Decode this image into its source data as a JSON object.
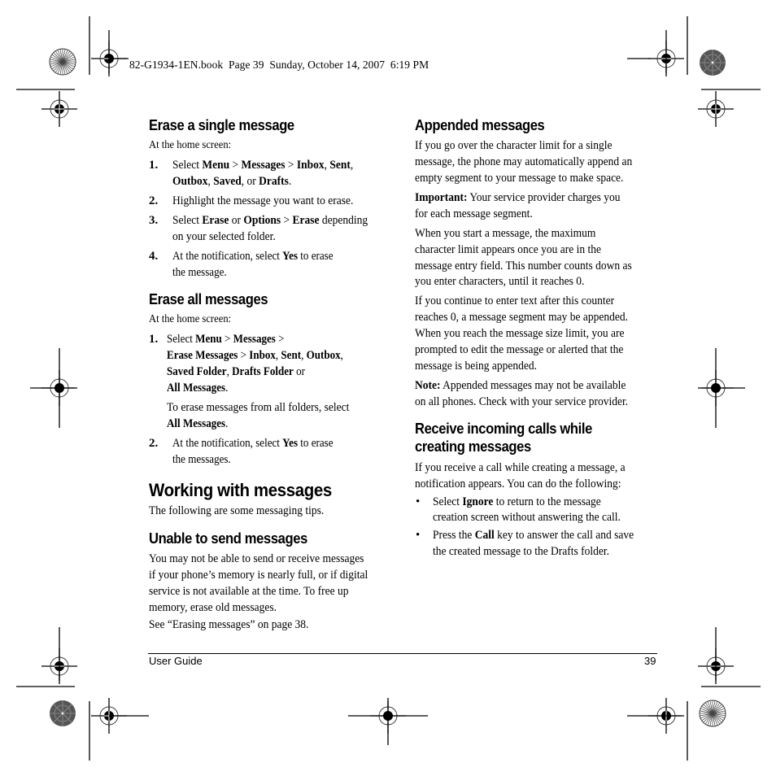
{
  "print_slug": "82-G1934-1EN.book  Page 39  Sunday, October 14, 2007  6:19 PM",
  "left_column": {
    "erase_single": {
      "heading": "Erase a single message",
      "intro": "At the home screen:",
      "steps": [
        {
          "num": "1.",
          "lines": [
            [
              {
                "t": "Select "
              },
              {
                "t": "Menu",
                "b": true
              },
              {
                "t": " > "
              },
              {
                "t": "Messages",
                "b": true
              },
              {
                "t": " > "
              },
              {
                "t": "Inbox",
                "b": true
              },
              {
                "t": ", "
              },
              {
                "t": "Sent",
                "b": true
              },
              {
                "t": ","
              }
            ],
            [
              {
                "t": "Outbox",
                "b": true
              },
              {
                "t": ", "
              },
              {
                "t": "Saved",
                "b": true
              },
              {
                "t": ", or "
              },
              {
                "t": "Drafts",
                "b": true
              },
              {
                "t": "."
              }
            ]
          ]
        },
        {
          "num": "2.",
          "lines": [
            [
              {
                "t": "Highlight the message you want to erase."
              }
            ]
          ]
        },
        {
          "num": "3.",
          "lines": [
            [
              {
                "t": "Select "
              },
              {
                "t": "Erase",
                "b": true
              },
              {
                "t": " or "
              },
              {
                "t": "Options",
                "b": true
              },
              {
                "t": " > "
              },
              {
                "t": "Erase",
                "b": true
              },
              {
                "t": " depending"
              }
            ],
            [
              {
                "t": "on your selected folder."
              }
            ]
          ]
        },
        {
          "num": "4.",
          "lines": [
            [
              {
                "t": "At the notification, select "
              },
              {
                "t": "Yes",
                "b": true
              },
              {
                "t": " to erase"
              }
            ],
            [
              {
                "t": "the message."
              }
            ]
          ]
        }
      ]
    },
    "erase_all": {
      "heading": "Erase all messages",
      "intro": "At the home screen:",
      "steps": [
        {
          "num": "1.",
          "lines": [
            [
              {
                "t": "Select "
              },
              {
                "t": "Menu",
                "b": true
              },
              {
                "t": " > "
              },
              {
                "t": "Messages",
                "b": true
              },
              {
                "t": " >"
              }
            ],
            [
              {
                "t": "Erase Messages",
                "b": true
              },
              {
                "t": " > "
              },
              {
                "t": "Inbox",
                "b": true
              },
              {
                "t": ", "
              },
              {
                "t": "Sent",
                "b": true
              },
              {
                "t": ", "
              },
              {
                "t": "Outbox",
                "b": true
              },
              {
                "t": ","
              }
            ],
            [
              {
                "t": "Saved Folder",
                "b": true
              },
              {
                "t": ", "
              },
              {
                "t": "Drafts Folder",
                "b": true
              },
              {
                "t": " or"
              }
            ],
            [
              {
                "t": "All Messages",
                "b": true
              },
              {
                "t": "."
              }
            ]
          ],
          "note_lines": [
            [
              {
                "t": "To erase messages from all folders, select"
              }
            ],
            [
              {
                "t": "All Messages",
                "b": true
              },
              {
                "t": "."
              }
            ]
          ]
        },
        {
          "num": "2.",
          "lines": [
            [
              {
                "t": "At the notification, select "
              },
              {
                "t": "Yes",
                "b": true
              },
              {
                "t": " to erase"
              }
            ],
            [
              {
                "t": "the messages."
              }
            ]
          ]
        }
      ]
    },
    "working": {
      "heading": "Working with messages",
      "intro": "The following are some messaging tips."
    },
    "unable": {
      "heading": "Unable to send messages",
      "lines": [
        "You may not be able to send or receive messages",
        "if your phone’s memory is nearly full, or if digital",
        "service is not available at the time. To free up",
        "memory, erase old messages."
      ],
      "see": "See “Erasing messages” on page 38."
    }
  },
  "right_column": {
    "appended": {
      "heading": "Appended messages",
      "para1": [
        "If you go over the character limit for a single",
        "message, the phone may automatically append an",
        "empty segment to your message to make space."
      ],
      "important_label": "Important:",
      "important_lines": [
        " Your service provider charges you",
        "for each message segment."
      ],
      "para2": [
        "When you start a message, the maximum",
        "character limit appears once you are in the",
        "message entry field. This number counts down as",
        "you enter characters, until it reaches 0."
      ],
      "para3": [
        "If you continue to enter text after this counter",
        "reaches 0, a message segment may be appended.",
        "When you reach the message size limit, you are",
        "prompted to edit the message or alerted that the",
        "message is being appended."
      ],
      "note_label": "Note:",
      "note_lines": [
        " Appended messages may not be available",
        "on all phones. Check with your service provider."
      ]
    },
    "incoming": {
      "heading_lines": [
        "Receive incoming calls while",
        "creating messages"
      ],
      "intro": [
        "If you receive a call while creating a message, a",
        "notification appears. You can do the following:"
      ],
      "bullets": [
        {
          "lines": [
            [
              {
                "t": "Select "
              },
              {
                "t": "Ignore",
                "b": true
              },
              {
                "t": " to return to the message"
              }
            ],
            [
              {
                "t": "creation screen without answering the call."
              }
            ]
          ]
        },
        {
          "lines": [
            [
              {
                "t": "Press the "
              },
              {
                "t": "Call",
                "b": true
              },
              {
                "t": " key to answer the call and save"
              }
            ],
            [
              {
                "t": "the created message to the Drafts folder."
              }
            ]
          ]
        }
      ],
      "bullet_glyph": "•"
    }
  },
  "footer": {
    "left": "User Guide",
    "page_number": "39"
  },
  "print_marks": {
    "registration_icon": "crosshair-registration-icon",
    "color_bar_icon": "starburst-icon"
  }
}
